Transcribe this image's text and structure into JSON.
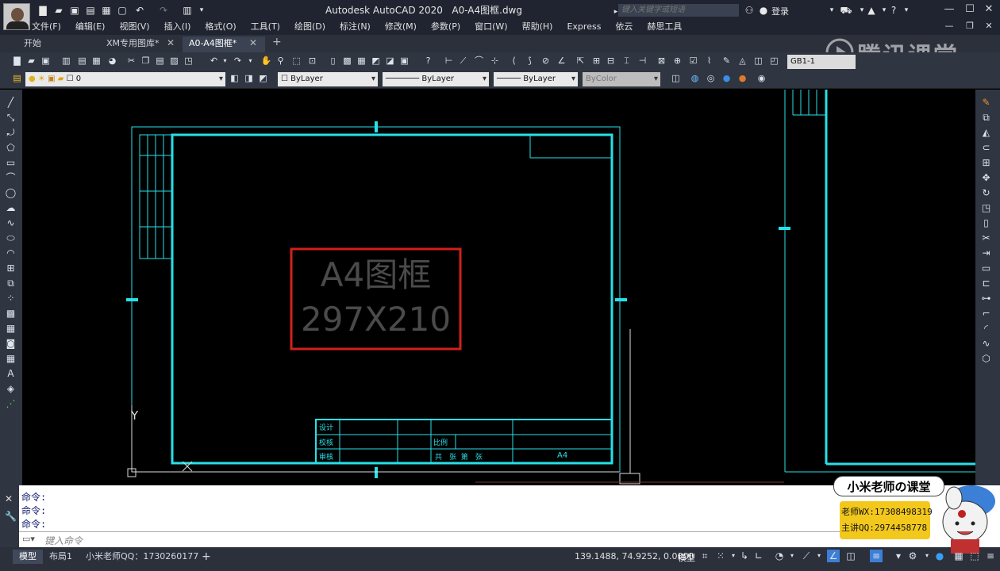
{
  "title_bar": {
    "app_name": "Autodesk AutoCAD 2020",
    "file_name": "A0-A4图框.dwg",
    "search_placeholder": "键入关键字或短语",
    "login_label": "登录"
  },
  "menu": [
    "文件(F)",
    "编辑(E)",
    "视图(V)",
    "插入(I)",
    "格式(O)",
    "工具(T)",
    "绘图(D)",
    "标注(N)",
    "修改(M)",
    "参数(P)",
    "窗口(W)",
    "帮助(H)",
    "Express",
    "依云",
    "赫思工具"
  ],
  "doc_tabs": [
    {
      "label": "开始",
      "active": false
    },
    {
      "label": "XM专用图库*",
      "active": false
    },
    {
      "label": "A0-A4图框*",
      "active": true
    }
  ],
  "toolbar": {
    "dimstyle": "GB1-1",
    "layer": "0",
    "color": "ByLayer",
    "linetype": "ByLayer",
    "lineweight": "ByLayer",
    "plotstyle": "ByColor"
  },
  "drawing": {
    "frame_label_line1": "A4图框",
    "frame_label_line2": "297X210",
    "title_block": {
      "design": "设计",
      "check": "校核",
      "review": "审核",
      "scale": "比例",
      "sheets": "共　张  第　张",
      "size": "A4"
    },
    "ucs_y": "Y",
    "colors": {
      "frame": "#28e0e8",
      "highlight_box": "#d0201d",
      "label_text": "#4a4a4a"
    }
  },
  "command": {
    "history": [
      "命令:",
      "命令:",
      "命令:"
    ],
    "placeholder": "键入命令"
  },
  "status": {
    "layout_tabs": [
      "模型",
      "布局1",
      "小米老师QQ：1730260177"
    ],
    "coords": "139.1488, 74.9252, 0.0000",
    "model_label": "模型"
  },
  "watermark": {
    "text": "腾讯课堂"
  },
  "promo": {
    "title": "小米老师の课堂",
    "wechat": "老师WX:17308498319",
    "qq": "主讲QQ:2974458778"
  }
}
